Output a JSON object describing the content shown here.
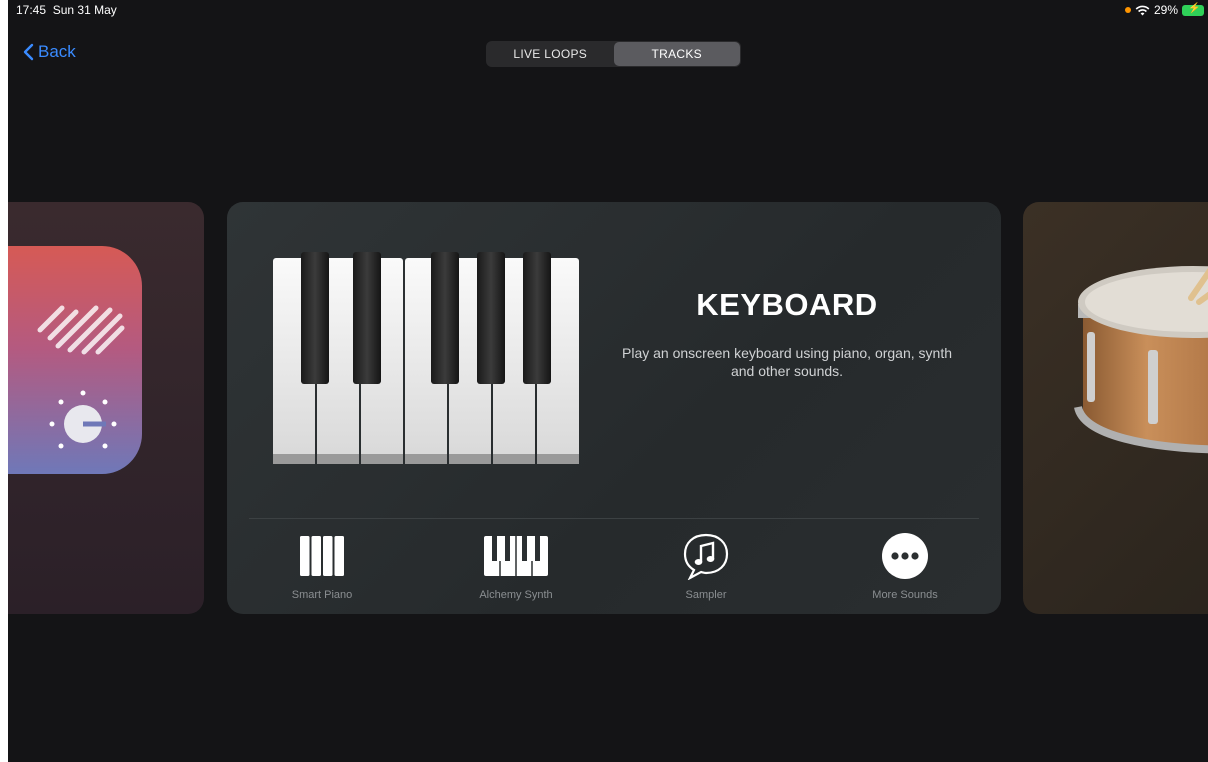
{
  "status_bar": {
    "time": "17:45",
    "date": "Sun 31 May",
    "battery": "29%"
  },
  "nav": {
    "back_label": "Back"
  },
  "segments": [
    {
      "label": "LIVE LOOPS",
      "active": false
    },
    {
      "label": "TRACKS",
      "active": true
    }
  ],
  "instrument": {
    "title": "KEYBOARD",
    "description": "Play an onscreen keyboard using piano, organ, synth and other sounds."
  },
  "sounds": [
    {
      "label": "Smart Piano",
      "icon": "piano-keys-icon"
    },
    {
      "label": "Alchemy Synth",
      "icon": "synth-keys-icon"
    },
    {
      "label": "Sampler",
      "icon": "music-note-bubble-icon"
    },
    {
      "label": "More Sounds",
      "icon": "ellipsis-circle-icon"
    }
  ],
  "colors": {
    "accent": "#3a8bff",
    "background": "#141416",
    "card": "#2c3133"
  }
}
